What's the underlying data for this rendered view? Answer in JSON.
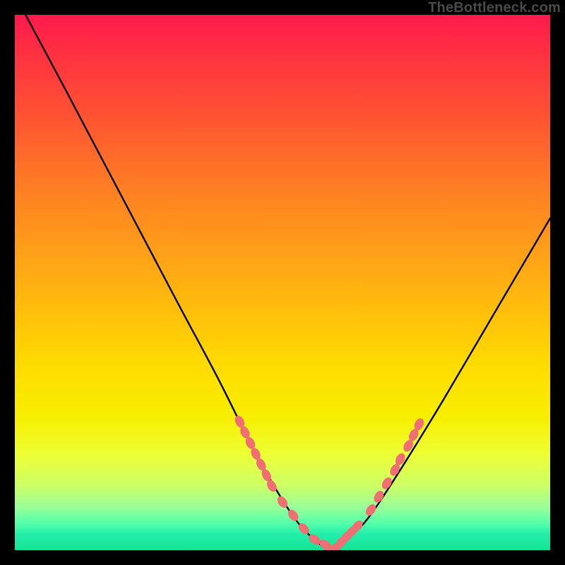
{
  "watermark": "TheBottleneck.com",
  "chart_data": {
    "type": "line",
    "title": "",
    "xlabel": "",
    "ylabel": "",
    "xlim": [
      0,
      100
    ],
    "ylim": [
      0,
      100
    ],
    "series": [
      {
        "name": "black-curve",
        "color": "#000000",
        "x": [
          2,
          10,
          20,
          30,
          38,
          44,
          49,
          53,
          56,
          59,
          62,
          66,
          72,
          80,
          90,
          100
        ],
        "y": [
          100,
          85,
          66,
          47,
          32,
          20,
          11,
          5,
          2,
          0,
          2,
          6,
          15,
          28,
          45,
          62
        ]
      }
    ],
    "highlight_points": {
      "name": "pink-dots",
      "color": "#ef6f72",
      "points": [
        [
          42.0,
          24.0
        ],
        [
          43.0,
          22.0
        ],
        [
          44.0,
          20.0
        ],
        [
          45.0,
          18.0
        ],
        [
          46.0,
          16.0
        ],
        [
          47.0,
          14.0
        ],
        [
          48.0,
          12.0
        ],
        [
          50.0,
          9.0
        ],
        [
          52.0,
          6.5
        ],
        [
          54.0,
          4.0
        ],
        [
          56.0,
          2.0
        ],
        [
          58.0,
          1.0
        ],
        [
          59.0,
          0.0
        ],
        [
          60.0,
          0.5
        ],
        [
          61.0,
          1.5
        ],
        [
          62.0,
          2.5
        ],
        [
          63.0,
          3.5
        ],
        [
          64.0,
          4.5
        ],
        [
          66.5,
          7.5
        ],
        [
          68.0,
          10.0
        ],
        [
          69.5,
          12.5
        ],
        [
          71.0,
          15.0
        ],
        [
          72.0,
          17.0
        ],
        [
          73.5,
          19.5
        ],
        [
          74.5,
          21.5
        ],
        [
          75.5,
          23.5
        ]
      ]
    }
  }
}
